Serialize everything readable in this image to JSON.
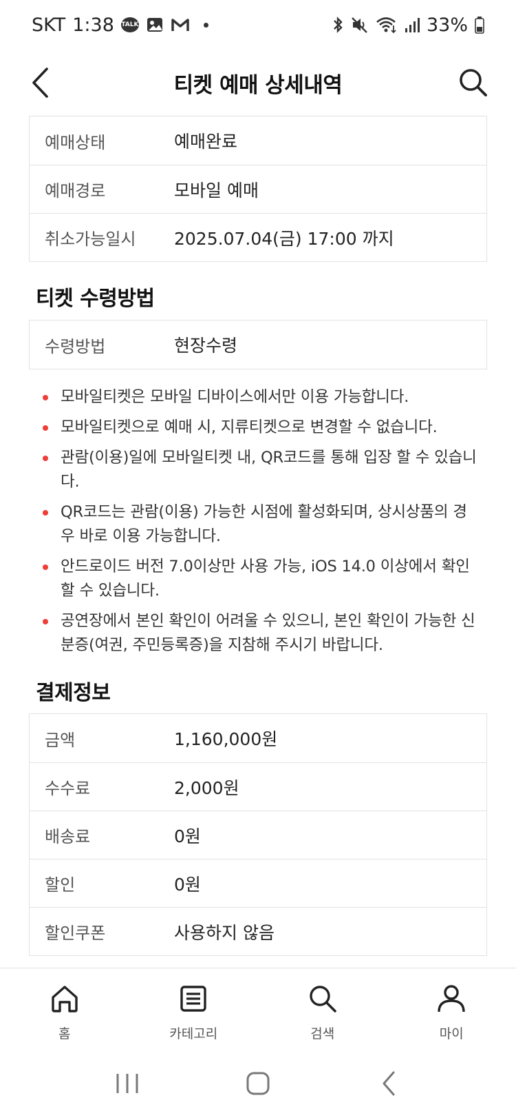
{
  "status_bar": {
    "carrier": "SKT",
    "time": "1:38",
    "talk_badge": "TALK",
    "battery": "33%"
  },
  "header": {
    "title": "티켓 예매 상세내역"
  },
  "reservation_info": [
    {
      "label": "예매상태",
      "value": "예매완료"
    },
    {
      "label": "예매경로",
      "value": "모바일 예매"
    },
    {
      "label": "취소가능일시",
      "value": "2025.07.04(금) 17:00 까지"
    }
  ],
  "ticket_receipt": {
    "title": "티켓 수령방법",
    "rows": [
      {
        "label": "수령방법",
        "value": "현장수령"
      }
    ],
    "notices": [
      "모바일티켓은 모바일 디바이스에서만 이용 가능합니다.",
      "모바일티켓으로 예매 시, 지류티켓으로 변경할 수 없습니다.",
      "관람(이용)일에 모바일티켓 내, QR코드를 통해 입장 할 수 있습니다.",
      "QR코드는 관람(이용) 가능한 시점에 활성화되며, 상시상품의 경우 바로 이용 가능합니다.",
      "안드로이드 버전 7.0이상만 사용 가능, iOS 14.0 이상에서 확인 할 수 있습니다.",
      "공연장에서 본인 확인이 어려울 수 있으니, 본인 확인이 가능한 신분증(여권, 주민등록증)을 지참해 주시기 바랍니다."
    ]
  },
  "payment": {
    "title": "결제정보",
    "rows": [
      {
        "label": "금액",
        "value": "1,160,000원"
      },
      {
        "label": "수수료",
        "value": "2,000원"
      },
      {
        "label": "배송료",
        "value": "0원"
      },
      {
        "label": "할인",
        "value": "0원"
      },
      {
        "label": "할인쿠폰",
        "value": "사용하지 않음"
      }
    ]
  },
  "bottom_nav": [
    {
      "label": "홈",
      "icon": "home-icon"
    },
    {
      "label": "카테고리",
      "icon": "category-icon"
    },
    {
      "label": "검색",
      "icon": "search-icon"
    },
    {
      "label": "마이",
      "icon": "person-icon"
    }
  ],
  "colors": {
    "bullet": "#ef3e36",
    "border": "#e2e2e2"
  }
}
